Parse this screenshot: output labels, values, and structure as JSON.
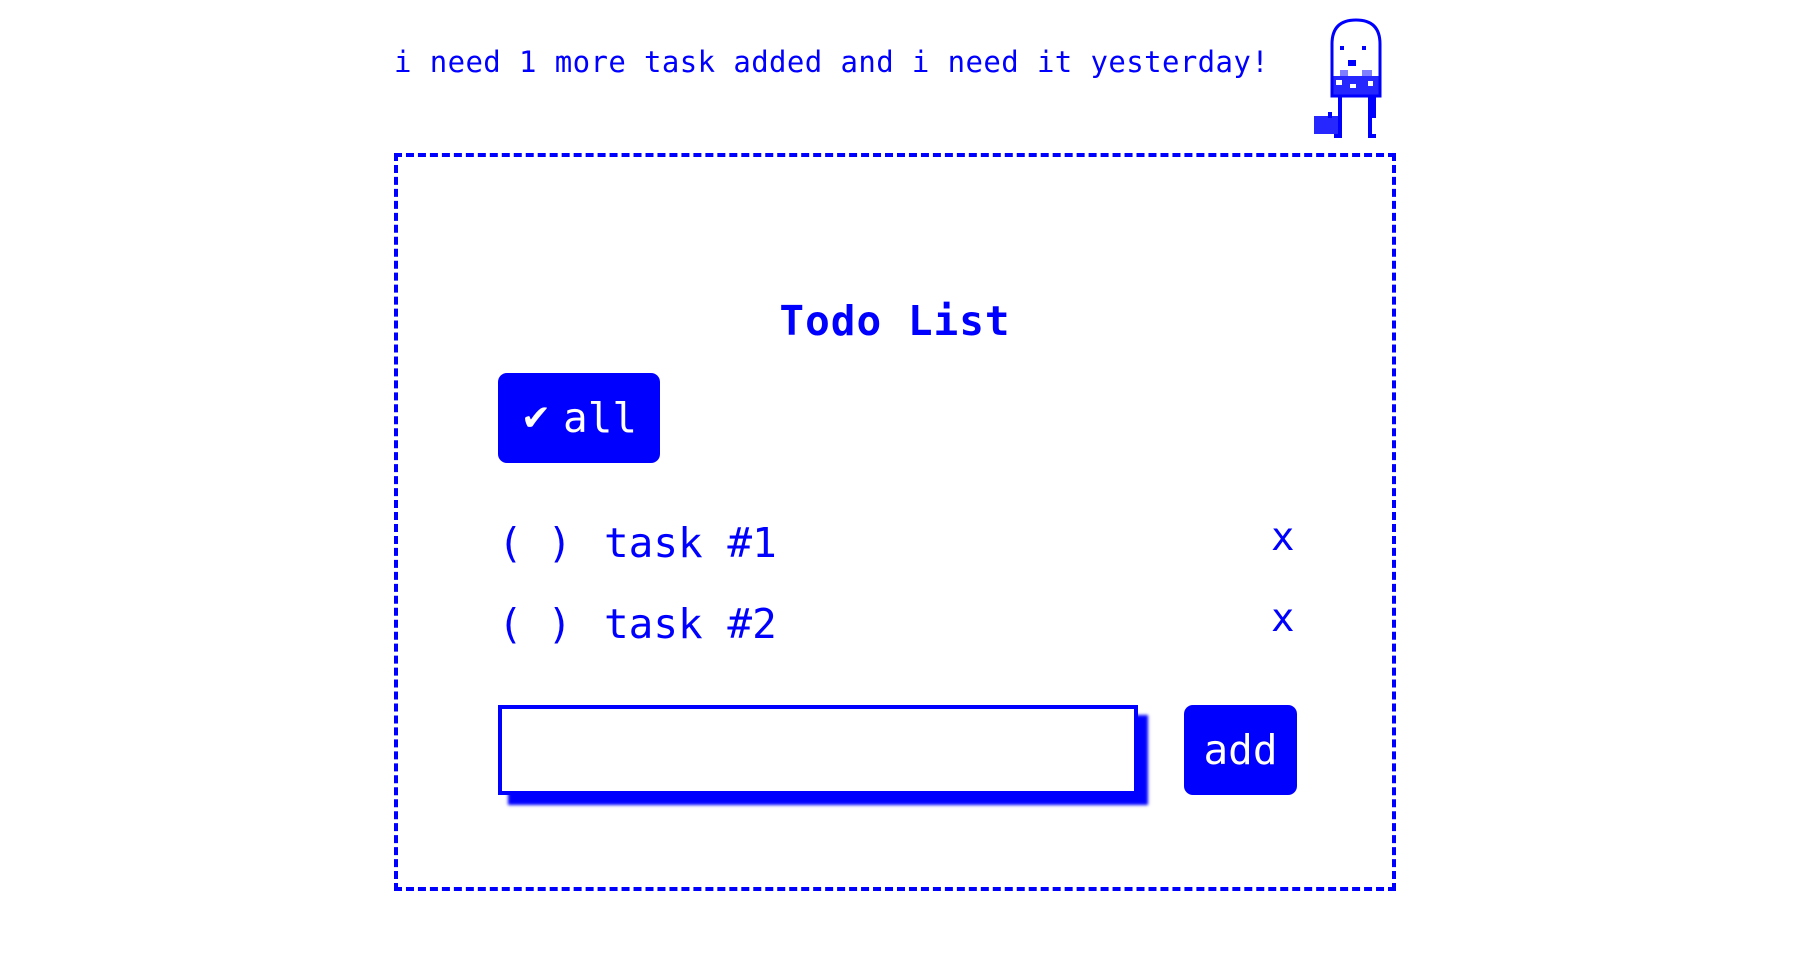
{
  "message": "i need 1 more task added and i need it yesterday!",
  "mascot": {
    "icon": "office-worker-ghost-icon"
  },
  "todo": {
    "title": "Todo List",
    "toggle_all": {
      "icon": "✔",
      "label": "all"
    },
    "tasks": [
      {
        "checkbox": "( )",
        "label": "task #1",
        "remove": "x",
        "done": false
      },
      {
        "checkbox": "( )",
        "label": "task #2",
        "remove": "x",
        "done": false
      }
    ],
    "new_task": {
      "value": "",
      "placeholder": ""
    },
    "add_label": "add"
  },
  "colors": {
    "accent": "#0000ff",
    "background": "#ffffff",
    "button_text": "#ffffff"
  }
}
